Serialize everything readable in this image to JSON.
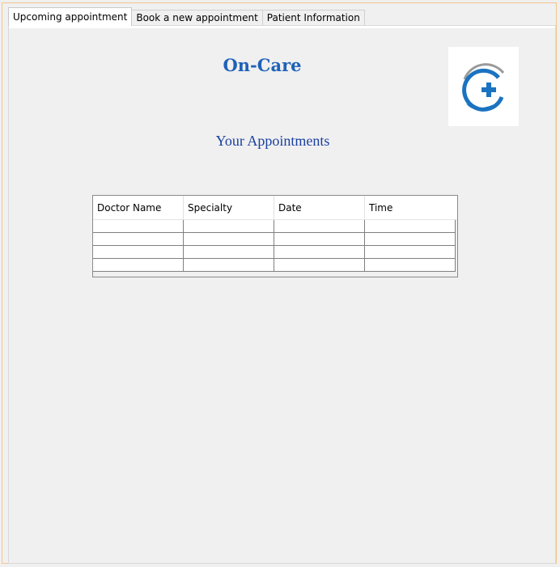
{
  "tabs": [
    {
      "label": "Upcoming appointment",
      "active": true
    },
    {
      "label": "Book a new appointment",
      "active": false
    },
    {
      "label": "Patient Information",
      "active": false
    }
  ],
  "header": {
    "title": "On-Care",
    "subtitle": "Your Appointments",
    "logo_icon": "medical-cross-hand-logo-icon"
  },
  "appointments_table": {
    "columns": [
      "Doctor Name",
      "Specialty",
      "Date",
      "Time"
    ],
    "rows": [
      [
        "",
        "",
        "",
        ""
      ],
      [
        "",
        "",
        "",
        ""
      ],
      [
        "",
        "",
        "",
        ""
      ],
      [
        "",
        "",
        "",
        ""
      ]
    ]
  },
  "colors": {
    "title": "#1f62b8",
    "subtitle": "#1a3fa0",
    "window_border": "#f3c58e",
    "logo_blue": "#1a73c0",
    "logo_gray": "#9a9a9a"
  }
}
